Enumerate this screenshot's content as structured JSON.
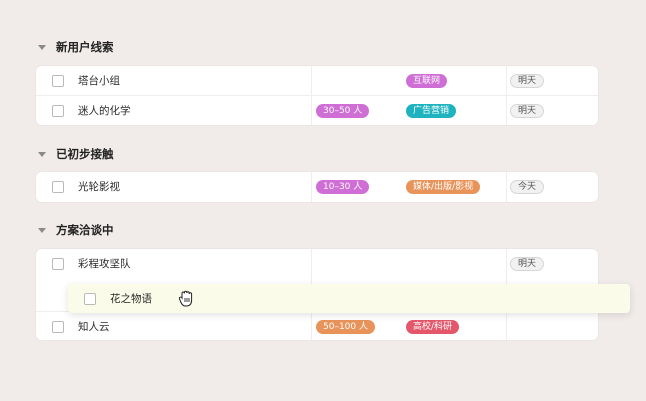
{
  "colors": {
    "purple": "#cf6fd6",
    "teal": "#1fb3c0",
    "orange": "#e8935a",
    "red": "#e4576b"
  },
  "sections": [
    {
      "title": "新用户线索",
      "rows": [
        {
          "name": "塔台小组",
          "size": "",
          "tag": "互联网",
          "tag_color": "purple",
          "date": "明天"
        },
        {
          "name": "迷人的化学",
          "size": "30–50 人",
          "size_color": "purple",
          "tag": "广告营销",
          "tag_color": "teal",
          "date": "明天"
        }
      ]
    },
    {
      "title": "已初步接触",
      "rows": [
        {
          "name": "光轮影视",
          "size": "10–30 人",
          "size_color": "purple",
          "tag": "媒体/出版/影视",
          "tag_color": "orange",
          "date": "今天"
        }
      ]
    },
    {
      "title": "方案洽谈中",
      "rows": [
        {
          "name": "彩程攻坚队",
          "size": "",
          "tag": "",
          "date": "明天"
        },
        {
          "name": "知人云",
          "size": "50–100 人",
          "size_color": "orange",
          "tag": "高校/科研",
          "tag_color": "red",
          "date": ""
        }
      ]
    }
  ],
  "dragging": {
    "name": "花之物语",
    "cursor_icon": "grab-hand-icon"
  }
}
